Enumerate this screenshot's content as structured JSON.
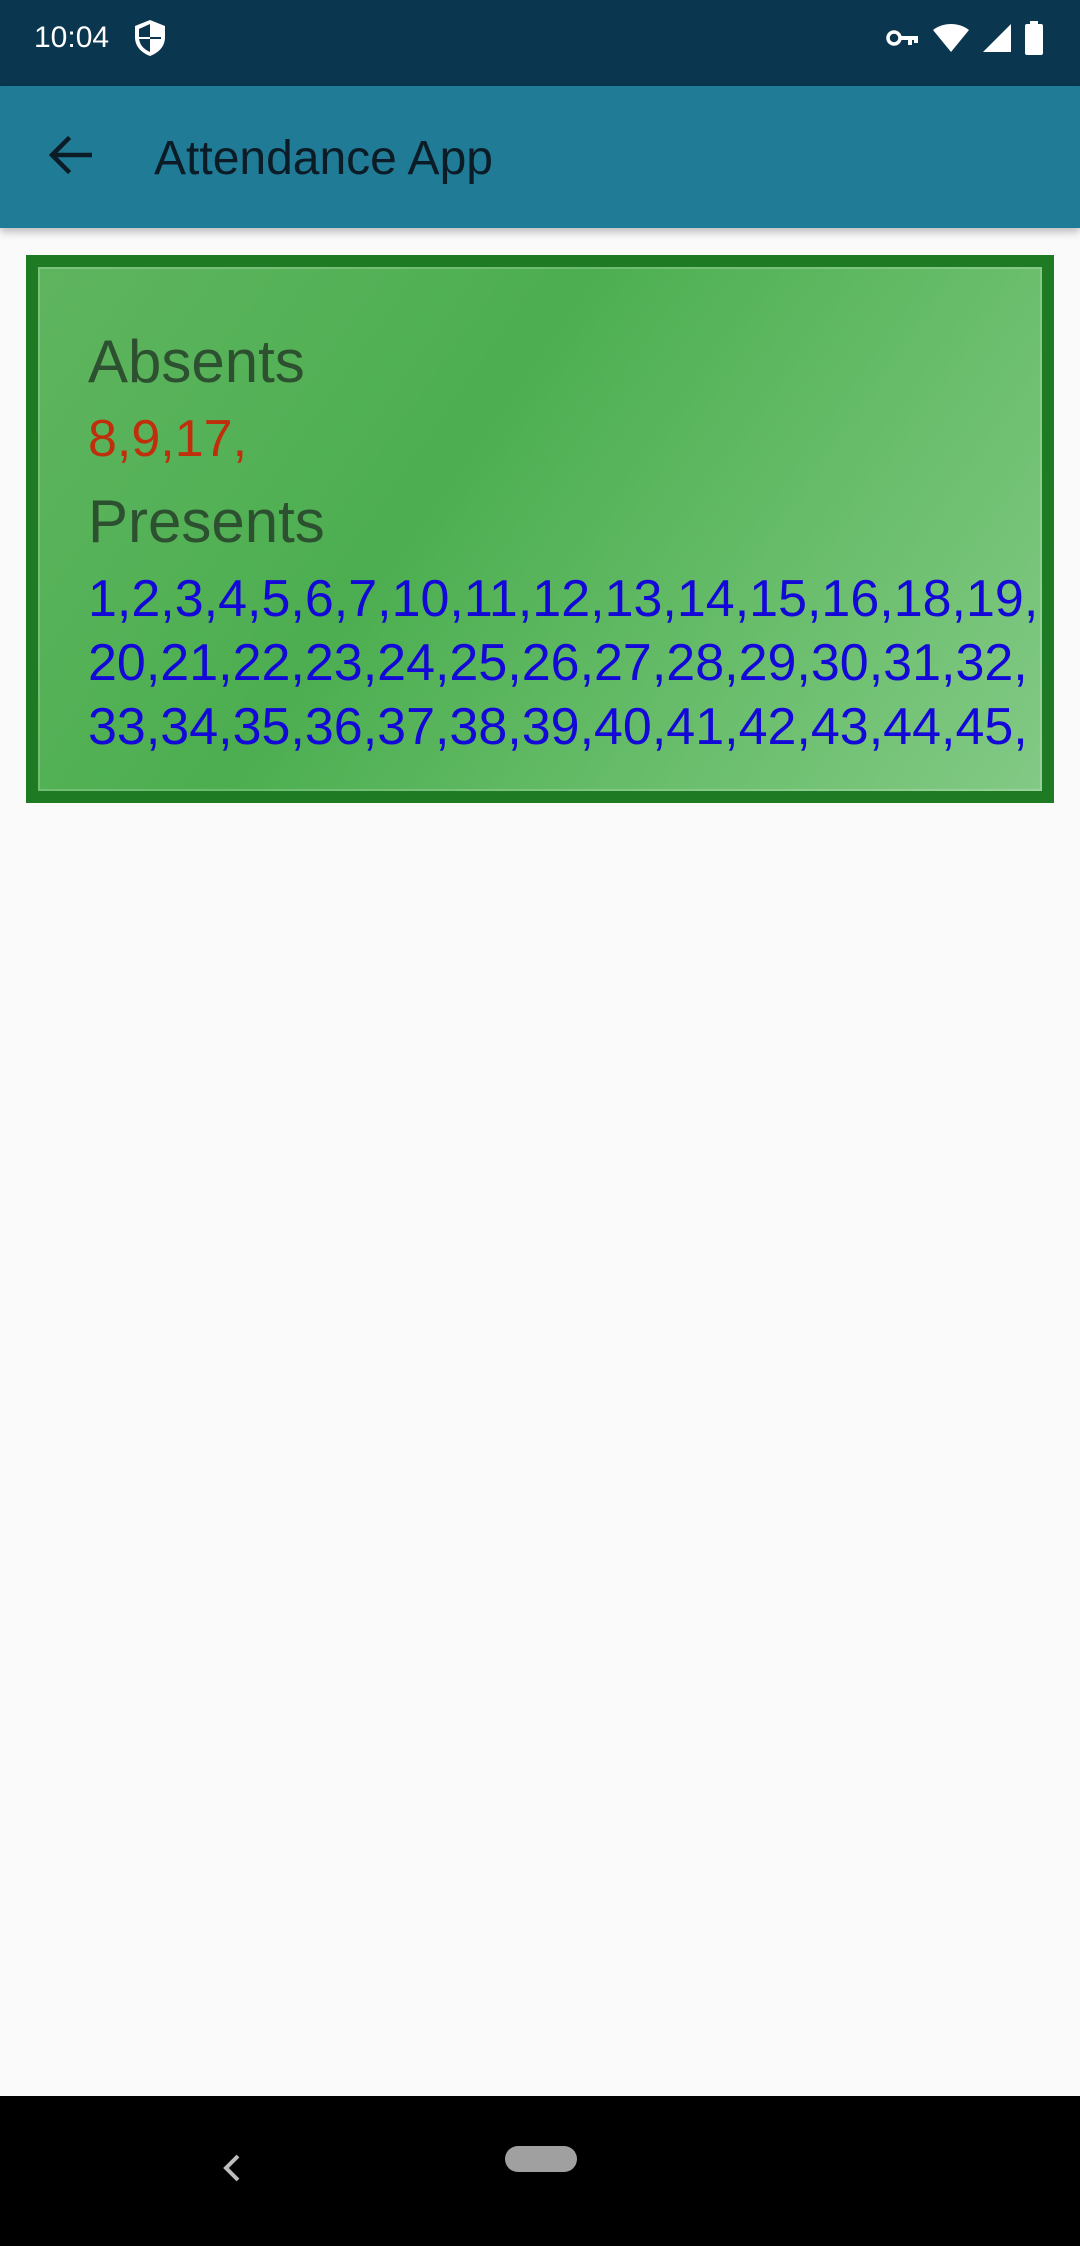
{
  "status_bar": {
    "time": "10:04",
    "icons": [
      "shield-icon",
      "vpn-key-icon",
      "wifi-icon",
      "signal-icon",
      "battery-icon"
    ]
  },
  "app_bar": {
    "back_icon": "arrow-back-icon",
    "title": "Attendance App"
  },
  "attendance": {
    "absents_heading": "Absents",
    "absents_value": "8,9,17,",
    "presents_heading": "Presents",
    "presents_lines": [
      "1,2,3,4,5,6,7,10,11,12,13,14,15,16,18,19,",
      "20,21,22,23,24,25,26,27,28,29,30,31,32,",
      "33,34,35,36,37,38,39,40,41,42,43,44,45,"
    ]
  },
  "nav_bar": {
    "back_icon": "chevron-left-icon",
    "home_icon": "home-pill-icon"
  },
  "colors": {
    "status_bar": "#0b3650",
    "app_bar": "#207b97",
    "card_border": "#1f7a24",
    "card_fill": "#4cae50",
    "heading_text": "#2d5030",
    "absent_text": "#c02f0c",
    "present_text": "#1308d8",
    "background": "#fafafa"
  }
}
